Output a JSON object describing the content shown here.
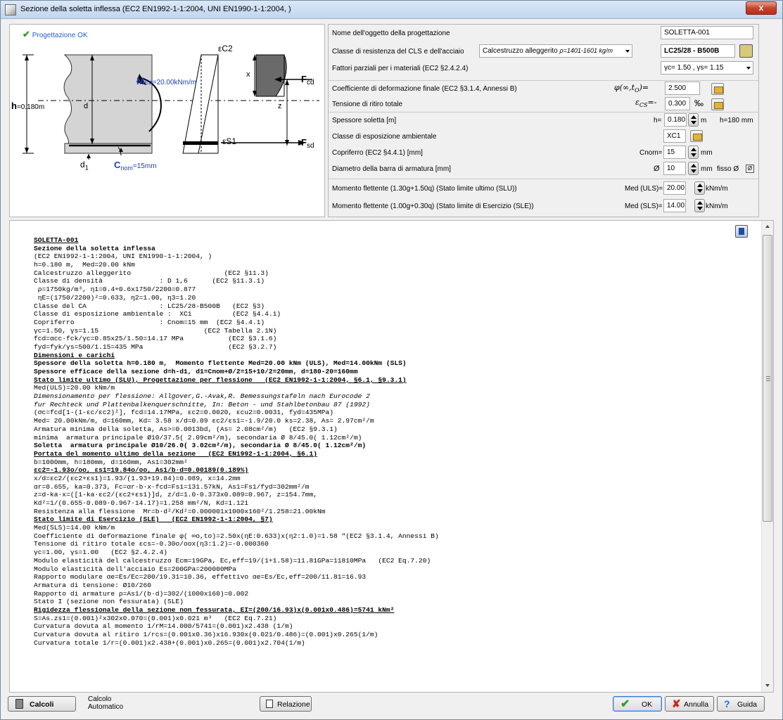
{
  "window": {
    "title": "Sezione della soletta inflessa (EC2 EN1992-1-1:2004, UNI EN1990-1-1:2004, )",
    "close_label": "x"
  },
  "diagram": {
    "status": "Progettazione OK",
    "ec2": "εC2",
    "x": "x",
    "z": "z",
    "d": "d",
    "h_label": "h",
    "h_value": "=0.180m",
    "m_label": "M",
    "m_sub": "Ed",
    "m_value": "=20.00kNm/m",
    "fcd": "F",
    "fcd_sub": "cd",
    "fsd": "F",
    "fsd_sub": "sd",
    "es1": "εS1",
    "d1": "d",
    "d1_sub": "1",
    "cnom": "C",
    "cnom_sub": "nom",
    "cnom_value": "=15mm"
  },
  "form": {
    "object_name_label": "Nome dell'oggetto della progettazione",
    "object_name_value": "SOLETTA-001",
    "class_label": "Classe di resistenza del CLS e dell'acciaio",
    "concrete_type": "Calcestruzzo alleggerito",
    "concrete_density": "ρ=1401-1601 kg/m",
    "class_value": "LC25/28 - B500B",
    "partial_label": "Fattori parziali per i materiali (EC2 §2.4.2.4)",
    "partial_value": "γc= 1.50 , γs= 1.15",
    "creep_label": "Coefficiente di deformazione finale (EC2 §3.1.4, Annessi B)",
    "creep_symbol": "φ(∞,t",
    "creep_symbol_sub": "O",
    "creep_symbol_end": ")=",
    "creep_value": "2.500",
    "shrink_label": "Tensione di ritiro totale",
    "shrink_symbol": "ε",
    "shrink_symbol_sub": "CS",
    "shrink_symbol_end": "=-",
    "shrink_value": "0.300",
    "shrink_unit": "‰",
    "thickness_label": "Spessore soletta [m]",
    "thickness_prefix": "h=",
    "thickness_value": "0.180",
    "thickness_unit": "m",
    "thickness_mm": "h=180 mm",
    "exposure_label": "Classe di esposizione ambientale",
    "exposure_value": "XC1",
    "cover_label": "Copriferro (EC2 §4.4.1) [mm]",
    "cover_prefix": "Cnom=",
    "cover_value": "15",
    "cover_unit": "mm",
    "bar_label": "Diametro della barra di armatura [mm]",
    "bar_prefix": "Ø",
    "bar_value": "10",
    "bar_unit": "mm",
    "bar_fixed": "fisso Ø",
    "med_uls_label": "Momento flettente (1.30g+1.50q) (Stato limite ultimo (SLU))",
    "med_uls_prefix": "Med (ULS)=",
    "med_uls_value": "20.00",
    "med_uls_unit": "kNm/m",
    "med_sls_label": "Momento flettente (1.00g+0.30q) (Stato limite di Esercizio (SLE))",
    "med_sls_prefix": "Med (SLS)=",
    "med_sls_value": "14.00",
    "med_sls_unit": "kNm/m"
  },
  "report_lines": [
    "SOLETTA-001",
    "Sezione della soletta inflessa",
    "(EC2 EN1992-1-1:2004, UNI EN1990-1-1:2004, )",
    "h=0.180 m,  Med=20.00 kNm",
    "Calcestruzzo alleggerito                       (EC2 §11.3)",
    "Classe di densità              : D 1,6      (EC2 §11.3.1)",
    " ρ=1750kg/m³, η1=0.4+0.6x1750/2200=0.877",
    " ηE=(1750/2200)²=0.633, η2=1.00, η3=1.20",
    "Classe del CA                  : LC25/28-B500B   (EC2 §3)",
    "Classe di esposizione ambientale :  XC1          (EC2 §4.4.1)",
    "Copriferro                     : Cnom=15 mm  (EC2 §4.4.1)",
    "γc=1.50, γs=1.15                          (EC2 Tabella 2.1N)",
    "fcd=αcc·fck/γc=0.85x25/1.50=14.17 MPa           (EC2 §3.1.6)",
    "fyd=fyk/γs=500/1.15=435 MPa                     (EC2 §3.2.7)",
    "Dimensioni e carichi",
    "Spessore della soletta h=0.180 m,  Momento flettente Med=20.00 kNm (ULS), Med=14.00kNm (SLS)",
    "Spessore efficace della sezione d=h-d1, d1=Cnom+Ø/2=15+10/2=20mm, d=180-20=160mm",
    "Stato limite ultimo (SLU), Progettazione per flessione   (EC2 EN1992-1-1:2004, §6.1, §9.3.1)",
    "Med(ULS)=20.00 kNm/m",
    "Dimensionamento per flessione: Allgover,G.-Avak,R. Bemessungstafeln nach Eurocode 2",
    "fur Rechteck und Plattenbalkenquerschnitte, In: Beton - und Stahlbetonbau 87 (1992)",
    "(σc=fcd[1-(1-εc/εc2)²], fcd=14.17MPa, εc2=0.0020, εcu2=0.0031, fyd=435MPa)",
    "Med= 20.00kNm/m, d=160mm, Kd= 3.58 x/d=0.09 εc2/εs1=-1.9/20.0 ks=2.38, As= 2.97cm²/m",
    "Armatura minima della soletta, As>=0.0013bd, (As= 2.08cm²/m)   (EC2 §9.3.1)",
    "minima  armatura principale Ø10/37.5( 2.09cm²/m), secondaria Ø 8/45.0( 1.12cm²/m)",
    "Soletta  armatura principale Ø10/26.0( 3.02cm²/m), secondaria Ø 8/45.0( 1.12cm²/m)",
    "Portata del momento ultimo della sezione   (EC2 EN1992-1-1:2004, §6.1)",
    "b=1000mm, h=180mm, d=160mm, As1=302mm²",
    "εc2=-1.93o/oo, εs1=19.84o/oo, As1/b·d=0.00189(0.189%)",
    "x/d=εc2/(εc2+εs1)=1.93/(1.93+19.84)=0.089, x=14.2mm",
    "αr=0.655, ka=0.373, Fc=αr·b·x·fcd=Fs1=131.57kN, As1=Fs1/fyd=302mm²/m",
    "z=d-ka·x=([1-ka·εc2/(εc2+εs1)]d, z/d=1.0-0.373x0.089=0.967, z=154.7mm,",
    "Kd²=1/(0.655·0.089·0.967·14.17)=1.258 mm²/N, Kd=1.121",
    "Resistenza alla flessione  Mr=b·d²/Kd²=0.000001x1000x160²/1.258=21.00kNm",
    "Stato limite di Esercizio (SLE)   (EC2 EN1992-1-1:2004, §7)",
    "Med(SLS)=14.00 kNm/m",
    "Coefficiente di deformazione finale φ( ∞o,to)=2.50x(ηE:0.633)x(η2:1.0)=1.58 \"(EC2 §3.1.4, Annessi B)",
    "Tensione di ritiro totale εcs=-0.30o/oox(η3:1.2)=-0.000360",
    "γc=1.00, γs=1.00   (EC2 §2.4.2.4)",
    "Modulo elasticità del calcestruzzo Ecm=19GPa, Ec,eff=19/(1+1.58)=11.81GPa=11810MPa   (EC2 Eq.7.20)",
    "Modulo elasticità dell'acciaio Es=200GPa=200000MPa",
    "Rapporto modulare αe=Es/Ec=200/19.31=10.36, effettivo αe=Es/Ec,eff=200/11.81=16.93",
    "Armatura di tensione: Ø10/260",
    "Rapporto di armature ρ=As1/(b·d)=302/(1000x160)=0.002",
    "Stato I (sezione non fessurata) (SLE)",
    "Rigidezza flessionale della sezione non fessurata, EI=(200/16.93)x(0.001x0.486)=5741 kNm²",
    "S=As.zs1=(0.001)²x302x0.070=(0.001)x0.021 m³   (EC2 Eq.7.21)",
    "Curvatura dovuta al momento 1/rM=14.000/5741=(0.001)x2.438 (1/m)",
    "Curvatura dovuta al ritiro 1/rcs=(0.001x0.36)x16.930x(0.021/0.486)=(0.001)x0.265(1/m)",
    "Curvatura totale 1/r=(0.001)x2.438+(0.001)x0.265=(0.001)x2.704(1/m)"
  ],
  "report_styles": [
    "rh",
    "rb",
    "",
    "",
    "",
    "",
    "",
    "",
    "",
    "",
    "",
    "",
    "",
    "",
    "rh",
    "rb",
    "rb",
    "rh",
    "",
    "ri",
    "ri",
    "",
    "",
    "",
    "",
    "rb",
    "rh",
    "",
    "rh",
    "",
    "",
    "",
    "",
    "",
    "rh",
    "",
    "",
    "",
    "",
    "",
    "",
    "",
    "",
    "",
    "",
    "rh",
    "",
    "",
    "",
    "",
    ""
  ],
  "buttons": {
    "calc": "Calcoli",
    "auto": "Calcolo\nAutomatico",
    "report": "Relazione",
    "ok": "OK",
    "cancel": "Annulla",
    "help": "Guida"
  },
  "colors": {
    "accent": "#1e6ed8",
    "ok_green": "#2f9e2f",
    "cancel_red": "#c8281e"
  }
}
